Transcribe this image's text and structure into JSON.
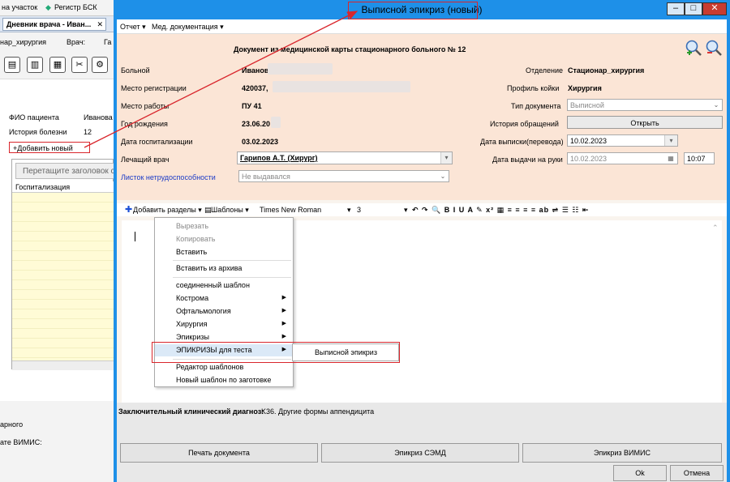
{
  "background": {
    "top_items": [
      "на участок",
      "Регистр БСК"
    ],
    "tab_label": "Дневник врача - Иван...",
    "tab_close": "✕",
    "row1": [
      "нар_хирургия",
      "Врач:",
      "Га"
    ],
    "patient_label": "ФИО пациента",
    "patient_value": "Иванова",
    "history_label": "История болезни",
    "history_value": "12",
    "add_new": "+Добавить новый",
    "grid_drag_hint": "Перетащите заголовок с",
    "grid_col": "Госпитализация",
    "bottom_labels": [
      "арного",
      "ате ВИМИС:"
    ]
  },
  "dialog": {
    "title": "Выписной эпикриз (новый)",
    "btn_min": "–",
    "btn_max": "□",
    "btn_close": "✕",
    "menu": [
      "Отчет ▾",
      "Мед. документация ▾"
    ],
    "doc_header": "Документ из медицинской карты стационарного больного №  12",
    "fields": {
      "patient_label": "Больной",
      "patient_value": "Иванова",
      "reg_label": "Место регистрации",
      "reg_value": "420037,",
      "work_label": "Место работы",
      "work_value": "ПУ 41",
      "birth_label": "Год рождения",
      "birth_value": "23.06.20",
      "hosp_label": "Дата госпитализации",
      "hosp_value": "03.02.2023",
      "doctor_label": "Лечащий врач",
      "doctor_value": "Гарипов А.Т. (Хирург)",
      "sick_label": "Листок нетрудоспособности",
      "sick_value": "Не выдавался",
      "dept_label": "Отделение",
      "dept_value": "Стационар_хирургия",
      "bed_label": "Профиль койки",
      "bed_value": "Хирургия",
      "doctype_label": "Тип документа",
      "doctype_value": "Выписной",
      "hist_label": "История обращений",
      "hist_button": "Открыть",
      "discharge_label": "Дата выписки(перевода)",
      "discharge_value": "10.02.2023",
      "issue_label": "Дата выдачи на руки",
      "issue_value": "10.02.2023",
      "issue_time": "10:07"
    },
    "toolbar": {
      "add_sections": "Добавить разделы ▾",
      "templates": "Шаблоны ▾",
      "font": "Times New Roman",
      "font_dd": "▾",
      "size": "3",
      "size_dd": "▾",
      "icons": "↶ ↷ 🔍 B I U A ✎ x² ▦ ≡ ≡ ≡ ≡ ab ⇌ ☰ ☷ ⇤"
    },
    "context_menu": {
      "items": [
        {
          "label": "Вырезать",
          "disabled": true
        },
        {
          "label": "Копировать",
          "disabled": true
        },
        {
          "label": "Вставить",
          "disabled": false
        },
        {
          "label": "Вставить из архива",
          "disabled": false
        },
        {
          "label": "соединенный шаблон",
          "disabled": false
        },
        {
          "label": "Кострома",
          "disabled": false,
          "submenu": true
        },
        {
          "label": "Офтальмология",
          "disabled": false,
          "submenu": true
        },
        {
          "label": "Хирургия",
          "disabled": false,
          "submenu": true
        },
        {
          "label": "Эпикризы",
          "disabled": false,
          "submenu": true
        },
        {
          "label": "ЭПИКРИЗЫ для теста",
          "disabled": false,
          "submenu": true,
          "highlight": true
        },
        {
          "label": "Редактор шаблонов",
          "disabled": false
        },
        {
          "label": "Новый шаблон по заготовке",
          "disabled": false
        }
      ],
      "submenu_item": "Выписной эпикриз",
      "submenu_arrow": "▶"
    },
    "diagnosis_label": "Заключительный клинический диагноз:",
    "diagnosis_value": "K36. Другие формы аппендицита",
    "buttons": {
      "print": "Печать документа",
      "semd": "Эпикриз СЭМД",
      "vimis": "Эпикриз ВИМИС",
      "ok": "Ok",
      "cancel": "Отмена"
    }
  },
  "colors": {
    "title_bar": "#1e90e8",
    "form_bg": "#fbe5d6",
    "highlight_box": "#d9262c",
    "arrow": "#d9262c"
  }
}
